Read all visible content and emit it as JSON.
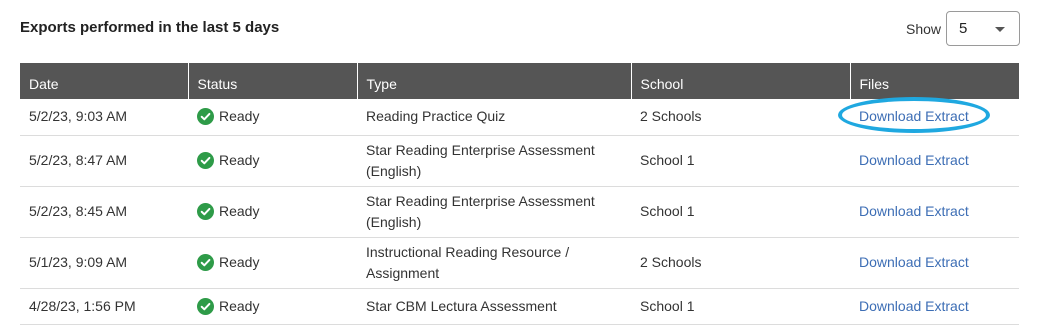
{
  "section": {
    "title": "Exports performed in the last 5 days"
  },
  "show": {
    "label": "Show",
    "value": "5"
  },
  "table": {
    "columns": [
      "Date",
      "Status",
      "Type",
      "School",
      "Files"
    ],
    "rows": [
      {
        "date": "5/2/23, 9:03 AM",
        "status": "Ready",
        "type": "Reading Practice Quiz",
        "school": "2 Schools",
        "files": "Download Extract"
      },
      {
        "date": "5/2/23, 8:47 AM",
        "status": "Ready",
        "type": "Star Reading Enterprise Assessment (English)",
        "school": "School 1",
        "files": "Download Extract"
      },
      {
        "date": "5/2/23, 8:45 AM",
        "status": "Ready",
        "type": "Star Reading Enterprise Assessment (English)",
        "school": "School 1",
        "files": "Download Extract"
      },
      {
        "date": "5/1/23, 9:09 AM",
        "status": "Ready",
        "type": "Instructional Reading Resource / Assignment",
        "school": "2 Schools",
        "files": "Download Extract"
      },
      {
        "date": "4/28/23, 1:56 PM",
        "status": "Ready",
        "type": "Star CBM Lectura Assessment",
        "school": "School 1",
        "files": "Download Extract"
      }
    ]
  },
  "colors": {
    "header_bg": "#555555",
    "status_green": "#2e9b48",
    "link_blue": "#3d6eb5",
    "highlight": "#1fa8e0"
  },
  "icons": {
    "status": "check-circle-icon",
    "dropdown": "chevron-down-icon"
  }
}
